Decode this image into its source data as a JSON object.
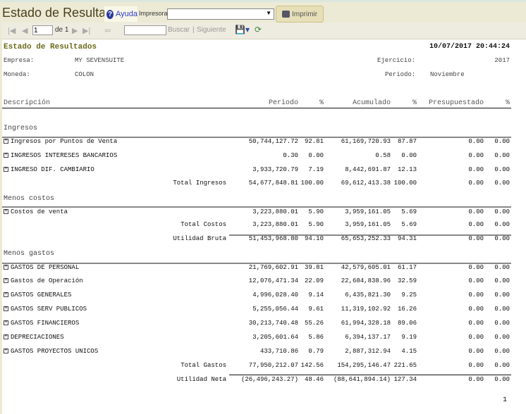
{
  "app": {
    "title": "Estado de Resultados",
    "help": "Ayuda",
    "printer_label": "Impresora:",
    "printer_value": "",
    "print_button": "Imprimir"
  },
  "toolbar": {
    "page": "1",
    "of": "de 1",
    "find_placeholder": "",
    "find": "Buscar",
    "separator": "|",
    "next": "Siguiente"
  },
  "report": {
    "title": "Estado de Resultados",
    "datetime": "10/07/2017 20:44:24",
    "empresa_label": "Empresa:",
    "empresa": "MY SEVENSUITE",
    "ejercicio_label": "Ejercicio:",
    "ejercicio": "2017",
    "moneda_label": "Moneda:",
    "moneda": "COLON",
    "periodo_label": "Periodo:",
    "periodo": "Noviembre",
    "columns": [
      "Descripción",
      "Periodo",
      "%",
      "Acumulado",
      "%",
      "Presupuestado",
      "%"
    ],
    "sections": [
      {
        "title": "Ingresos",
        "rows": [
          [
            "Ingresos por Puntos de Venta",
            "50,744,127.72",
            "92.81",
            "61,169,720.93",
            "87.87",
            "0.00",
            "0.00"
          ],
          [
            "INGRESOS INTERESES BANCARIOS",
            "0.30",
            "0.00",
            "0.58",
            "0.00",
            "0.00",
            "0.00"
          ],
          [
            "INGRESO DIF. CAMBIARIO",
            "3,933,720.79",
            "7.19",
            "8,442,691.87",
            "12.13",
            "0.00",
            "0.00"
          ]
        ],
        "totals": [
          [
            "Total Ingresos",
            "54,677,848.81",
            "100.00",
            "69,612,413.38",
            "100.00",
            "0.00",
            "0.00"
          ]
        ]
      },
      {
        "title": "Menos costos",
        "rows": [
          [
            "Costos de venta",
            "3,223,880.01",
            "5.90",
            "3,959,161.05",
            "5.69",
            "0.00",
            "0.00"
          ]
        ],
        "totals": [
          [
            "Total Costos",
            "3,223,880.01",
            "5.90",
            "3,959,161.05",
            "5.69",
            "0.00",
            "0.00"
          ],
          [
            "Utilidad Bruta",
            "51,453,968.80",
            "94.10",
            "65,653,252.33",
            "94.31",
            "0.00",
            "0.00"
          ]
        ]
      },
      {
        "title": "Menos gastos",
        "rows": [
          [
            "GASTOS DE PERSONAL",
            "21,769,602.91",
            "39.81",
            "42,579,605.01",
            "61.17",
            "0.00",
            "0.00"
          ],
          [
            "Gastos de Operación",
            "12,076,471.34",
            "22.09",
            "22,684,838.96",
            "32.59",
            "0.00",
            "0.00"
          ],
          [
            "GASTOS GENERALES",
            "4,996,028.40",
            "9.14",
            "6,435,821.30",
            "9.25",
            "0.00",
            "0.00"
          ],
          [
            "GASTOS SERV PUBLICOS",
            "5,255,056.44",
            "9.61",
            "11,319,102.92",
            "16.26",
            "0.00",
            "0.00"
          ],
          [
            "GASTOS FINANCIEROS",
            "30,213,740.48",
            "55.26",
            "61,994,328.18",
            "89.06",
            "0.00",
            "0.00"
          ],
          [
            "DEPRECIACIONES",
            "3,205,601.64",
            "5.86",
            "6,394,137.17",
            "9.19",
            "0.00",
            "0.00"
          ],
          [
            "GASTOS PROYECTOS UNICOS",
            "433,710.86",
            "0.79",
            "2,887,312.94",
            "4.15",
            "0.00",
            "0.00"
          ]
        ],
        "totals": [
          [
            "Total Gastos",
            "77,950,212.07",
            "142.56",
            "154,295,146.47",
            "221.65",
            "0.00",
            "0.00"
          ],
          [
            "Utilidad Neta",
            "(26,496,243.27)",
            "48.46",
            "(88,641,894.14)",
            "127.34",
            "0.00",
            "0.00"
          ]
        ]
      }
    ],
    "page_number": "1"
  }
}
